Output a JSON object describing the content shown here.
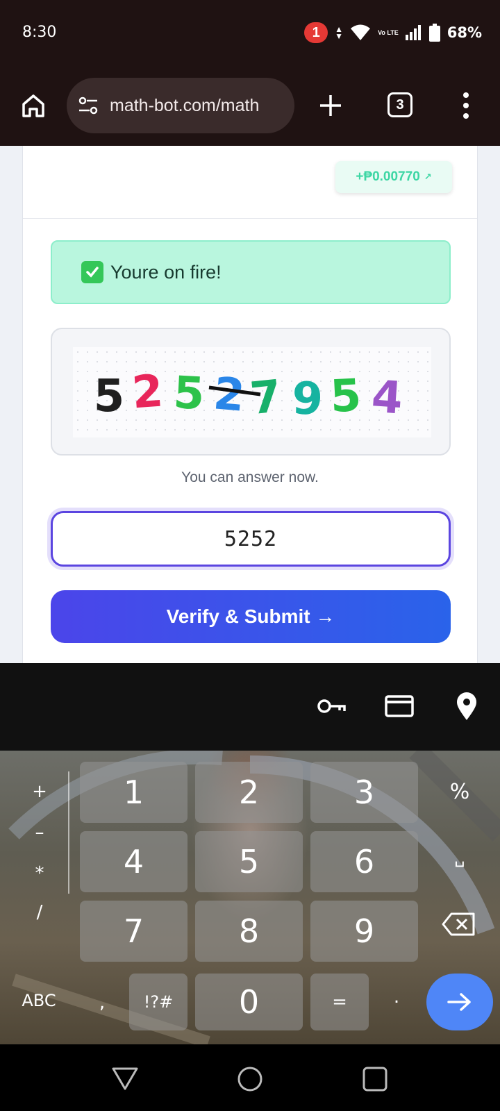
{
  "status_bar": {
    "time": "8:30",
    "notification_count": "1",
    "network_label": "Vo LTE",
    "battery": "68%"
  },
  "browser": {
    "url": "math-bot.com/math",
    "tab_count": "3"
  },
  "page": {
    "earning": "+₱0.00770",
    "earning_arrow": "↗",
    "success_message": "Youre on fire!",
    "captcha_digits": [
      "5",
      "2",
      "5",
      "2",
      "7",
      "9",
      "5",
      "4"
    ],
    "captcha_colors": [
      "#1f1f1f",
      "#e8265a",
      "#2dc24a",
      "#2a86e8",
      "#18b06a",
      "#16b3a0",
      "#27c24a",
      "#9b55c8"
    ],
    "captcha_hint": "You can answer now.",
    "answer_value": "5252",
    "submit_label": "Verify & Submit →"
  },
  "keyboard": {
    "toolbar_icons": [
      "key-icon",
      "credit-card-icon",
      "location-pin-icon"
    ],
    "digit_rows": [
      [
        "1",
        "2",
        "3"
      ],
      [
        "4",
        "5",
        "6"
      ],
      [
        "7",
        "8",
        "9"
      ]
    ],
    "left_symbols": [
      "+",
      "–",
      "*",
      "/"
    ],
    "right_keys": [
      "%",
      "␣"
    ],
    "bottom_row": {
      "abc": "ABC",
      "comma": ",",
      "symbols": "!?#",
      "zero": "0",
      "equals": "=",
      "period": "."
    }
  },
  "colors": {
    "accent": "#5b45e0",
    "submit_gradient_start": "#4b45ea",
    "submit_gradient_end": "#2a63ea",
    "success_bg": "#b9f6de",
    "earning_text": "#3dd6a4",
    "enter_key": "#4f86f7"
  }
}
